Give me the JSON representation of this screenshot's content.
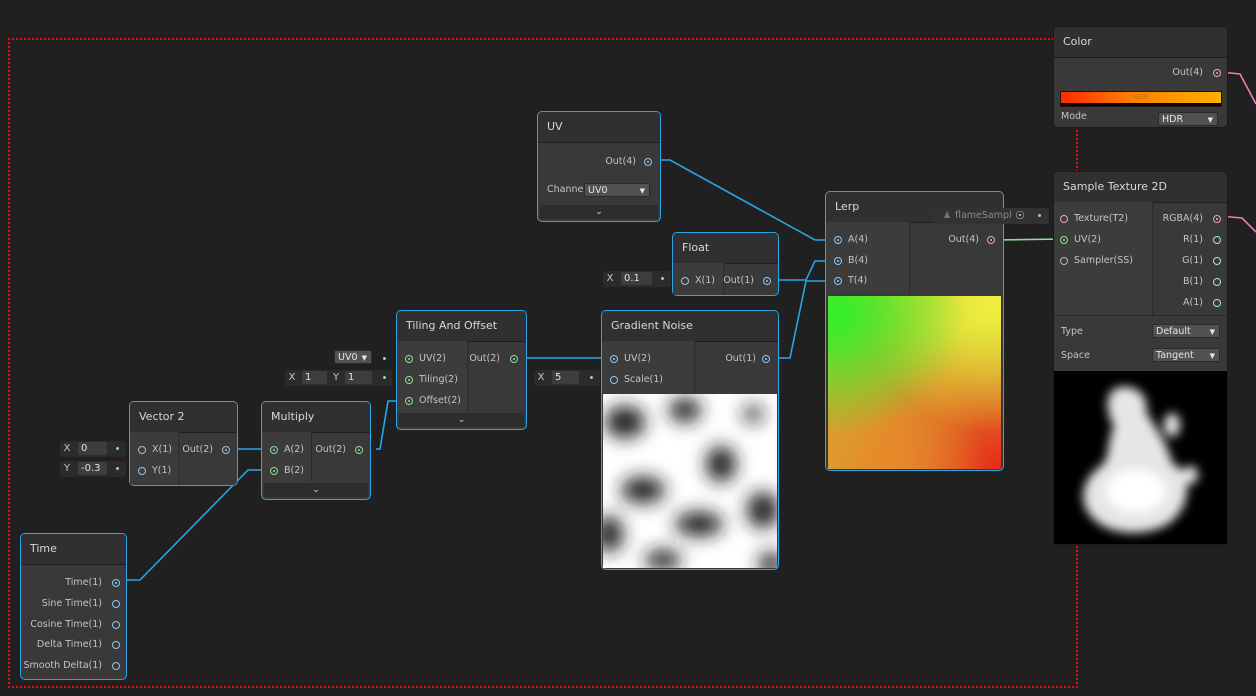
{
  "colors": {
    "background": "#202020",
    "node": "#393939",
    "selection": "#2aa5e8",
    "wire": "#2aa5e8",
    "dashed_frame": "#e01010",
    "ramp_from": "#ff3000",
    "ramp_to": "#ffa800"
  },
  "nodes": {
    "time": {
      "title": "Time",
      "outputs": [
        "Time(1)",
        "Sine Time(1)",
        "Cosine Time(1)",
        "Delta Time(1)",
        "Smooth Delta(1)"
      ]
    },
    "vector2": {
      "title": "Vector 2",
      "inputs": [
        "X(1)",
        "Y(1)"
      ],
      "output": "Out(2)",
      "x_label": "X",
      "x_value": "0",
      "y_label": "Y",
      "y_value": "-0.3"
    },
    "multiply": {
      "title": "Multiply",
      "inputs": [
        "A(2)",
        "B(2)"
      ],
      "output": "Out(2)"
    },
    "tiling": {
      "title": "Tiling And Offset",
      "inputs": [
        "UV(2)",
        "Tiling(2)",
        "Offset(2)"
      ],
      "output": "Out(2)",
      "uv_value": "UV0",
      "tiling_x_label": "X",
      "tiling_x": "1",
      "tiling_y_label": "Y",
      "tiling_y": "1"
    },
    "uv": {
      "title": "UV",
      "output": "Out(4)",
      "channel_label": "Channel",
      "channel_value": "UV0"
    },
    "float": {
      "title": "Float",
      "input": "X(1)",
      "output": "Out(1)",
      "x_label": "X",
      "x_value": "0.1"
    },
    "gradient_noise": {
      "title": "Gradient Noise",
      "inputs": [
        "UV(2)",
        "Scale(1)"
      ],
      "output": "Out(1)",
      "scale_label": "X",
      "scale_value": "5"
    },
    "lerp": {
      "title": "Lerp",
      "inputs": [
        "A(4)",
        "B(4)",
        "T(4)"
      ],
      "output": "Out(4)"
    },
    "color": {
      "title": "Color",
      "output": "Out(4)",
      "hdr_label": "HDR",
      "mode_label": "Mode",
      "mode_value": "HDR"
    },
    "sample_texture": {
      "title": "Sample Texture 2D",
      "inputs": [
        "Texture(T2)",
        "UV(2)",
        "Sampler(SS)"
      ],
      "outputs": [
        "RGBA(4)",
        "R(1)",
        "G(1)",
        "B(1)",
        "A(1)"
      ],
      "texture_field": "flameSampl",
      "type_label": "Type",
      "type_value": "Default",
      "space_label": "Space",
      "space_value": "Tangent"
    }
  },
  "icons": [
    "chevron-down-icon",
    "dropdown-arrow-icon",
    "target-icon",
    "person-icon"
  ]
}
